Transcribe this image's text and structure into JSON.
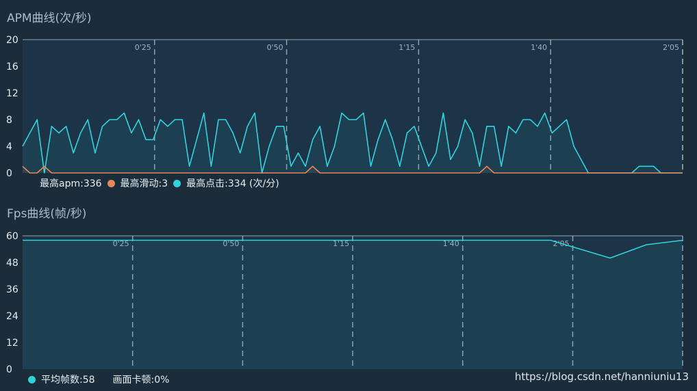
{
  "chart_data": [
    {
      "type": "area",
      "title": "APM曲线(次/秒)",
      "ylim": [
        0,
        20
      ],
      "yticks": [
        "0",
        "4",
        "8",
        "12",
        "16",
        "20"
      ],
      "time_marks": [
        "0'25",
        "0'50",
        "1'15",
        "1'40",
        "2'05"
      ],
      "grid": "vertical dashed at time marks",
      "legend": {
        "apm": "最高apm:336",
        "slide": "最高滑动:3",
        "click": "最高点击:334 (次/分)"
      },
      "colors": {
        "click": "#2fd3de",
        "slide": "#e8875a"
      },
      "series": [
        {
          "key": "click",
          "values": [
            4,
            6,
            8,
            0,
            7,
            6,
            7,
            3,
            6,
            8,
            3,
            7,
            8,
            8,
            9,
            6,
            8,
            5,
            5,
            8,
            7,
            8,
            8,
            1,
            5,
            9,
            1,
            8,
            8,
            6,
            3,
            7,
            9,
            0,
            4,
            7,
            7,
            1,
            3,
            1,
            5,
            7,
            1,
            4,
            9,
            8,
            8,
            9,
            1,
            5,
            8,
            5,
            1,
            6,
            7,
            4,
            1,
            3,
            9,
            2,
            4,
            8,
            6,
            1,
            7,
            7,
            1,
            7,
            6,
            8,
            8,
            7,
            9,
            6,
            7,
            8,
            4,
            2,
            0,
            0,
            0,
            0,
            0,
            0,
            0,
            1,
            1,
            1,
            0,
            0,
            0,
            0
          ]
        },
        {
          "key": "slide",
          "values": [
            1,
            0,
            0,
            1,
            0,
            0,
            0,
            0,
            0,
            0,
            0,
            0,
            0,
            0,
            0,
            0,
            0,
            0,
            0,
            0,
            0,
            0,
            0,
            0,
            0,
            0,
            0,
            0,
            0,
            0,
            0,
            0,
            0,
            0,
            0,
            0,
            0,
            0,
            0,
            0,
            1,
            0,
            0,
            0,
            0,
            0,
            0,
            0,
            0,
            0,
            0,
            0,
            0,
            0,
            0,
            0,
            0,
            0,
            0,
            0,
            0,
            0,
            0,
            0,
            1,
            0,
            0,
            0,
            0,
            0,
            0,
            0,
            0,
            0,
            0,
            0,
            0,
            0,
            0,
            0,
            0,
            0,
            0,
            0,
            0,
            0,
            0,
            0,
            0,
            0,
            0,
            0
          ]
        }
      ]
    },
    {
      "type": "area",
      "title": "Fps曲线(帧/秒)",
      "ylim": [
        0,
        60
      ],
      "yticks": [
        "0",
        "12",
        "24",
        "36",
        "48",
        "60"
      ],
      "time_marks": [
        "0'25",
        "0'50",
        "1'15",
        "1'40",
        "2'05"
      ],
      "grid": "vertical dashed at time marks",
      "legend": {
        "avg": "平均帧数:58",
        "stutter": "画面卡顿:0%"
      },
      "colors": {
        "fps": "#2fd3de"
      },
      "series": [
        {
          "key": "fps",
          "x": [
            0,
            0.8,
            0.89,
            0.945,
            1.0
          ],
          "values": [
            58,
            58,
            50,
            56,
            58
          ]
        }
      ]
    }
  ],
  "watermark": "https://blog.csdn.net/hanniuniu13"
}
